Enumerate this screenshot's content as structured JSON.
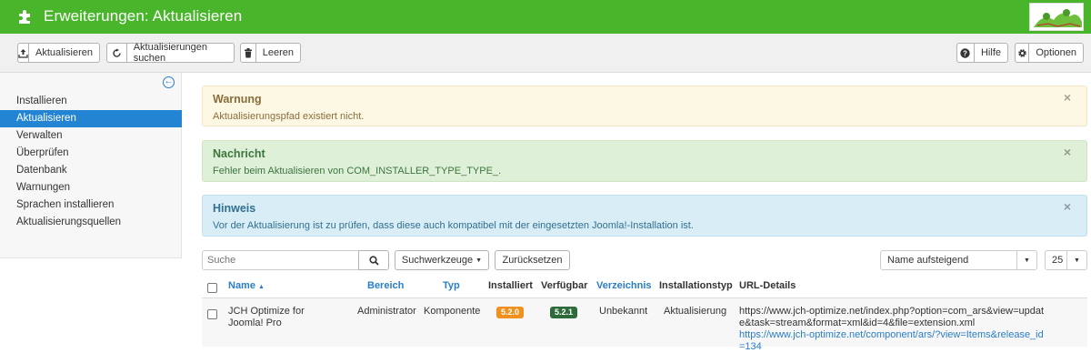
{
  "header": {
    "title": "Erweiterungen: Aktualisieren",
    "bar_color": "#48b52b"
  },
  "toolbar": {
    "update_label": "Aktualisieren",
    "find_updates_label": "Aktualisierungen suchen",
    "clear_label": "Leeren",
    "help_label": "Hilfe",
    "options_label": "Optionen"
  },
  "sidebar": {
    "items": [
      {
        "label": "Installieren"
      },
      {
        "label": "Aktualisieren"
      },
      {
        "label": "Verwalten"
      },
      {
        "label": "Überprüfen"
      },
      {
        "label": "Datenbank"
      },
      {
        "label": "Warnungen"
      },
      {
        "label": "Sprachen installieren"
      },
      {
        "label": "Aktualisierungsquellen"
      }
    ],
    "active_index": 1
  },
  "alerts": {
    "warning": {
      "heading": "Warnung",
      "text": "Aktualisierungspfad existiert nicht."
    },
    "message": {
      "heading": "Nachricht",
      "text": "Fehler beim Aktualisieren von COM_INSTALLER_TYPE_TYPE_."
    },
    "notice": {
      "heading": "Hinweis",
      "text": "Vor der Aktualisierung ist zu prüfen, dass diese auch kompatibel mit der eingesetzten Joomla!-Installation ist."
    },
    "close": "×"
  },
  "filters": {
    "search_placeholder": "Suche",
    "search_tools_label": "Suchwerkzeuge",
    "reset_label": "Zurücksetzen",
    "sort_value": "Name aufsteigend",
    "limit_value": "25"
  },
  "table": {
    "headers": {
      "name": "Name",
      "area": "Bereich",
      "type": "Typ",
      "installed": "Installiert",
      "available": "Verfügbar",
      "folder": "Verzeichnis",
      "install_type": "Installationstyp",
      "url": "URL-Details"
    },
    "rows": [
      {
        "name": "JCH Optimize for Joomla! Pro",
        "area": "Administrator",
        "type": "Komponente",
        "installed": "5.2.0",
        "available": "5.2.1",
        "folder": "Unbekannt",
        "install_type": "Aktualisierung",
        "url": "https://www.jch-optimize.net/index.php?option=com_ars&view=update&task=stream&format=xml&id=4&file=extension.xml",
        "info_url": "https://www.jch-optimize.net/component/ars/?view=Items&release_id=134"
      }
    ]
  },
  "colors": {
    "installed_badge": "#f0901f",
    "available_badge": "#2e6b3a",
    "active_nav": "#2384d3",
    "link": "#2a7dc7"
  }
}
